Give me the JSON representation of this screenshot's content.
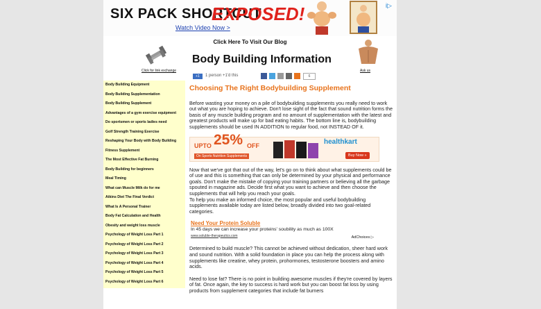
{
  "banner": {
    "title_part1": "SIX PACK SHORTCUT",
    "title_part2": "EXPOSED!",
    "cta": "Watch Video Now >",
    "ad_marker": "i▷"
  },
  "topnav": {
    "blog_link": "Click Here To Visit Our Blog"
  },
  "header": {
    "title": "Body Building Information",
    "left_link": "Click for link exchange",
    "right_link": "Ask us"
  },
  "social": {
    "google_count": "+1",
    "google_text": "1 person +1'd this",
    "share_count": "6"
  },
  "sidebar": {
    "items": [
      "Body Building Equipment",
      "Body Building Supplementation",
      "Body Building Supplement",
      "Advantages of a gym exercise equipment",
      "Do sportsmen or sports ladies need",
      "Golf Strength Training Exercise",
      "Reshaping Your Body with Body Building",
      "Fitness Supplement",
      "The Most Effective Fat Burning",
      "Body Building for beginners",
      "Meal Timing",
      "What can Muscle Milk do for me",
      "Atkins Diet The Final Verdict",
      "What Is A Personal Trainer",
      "Body Fat Calculation and Health",
      "Obesity and weight loss muscle",
      "Psychology of Weight Loss Part 1",
      "Psychology of Weight Loss Part 2",
      "Psychology of Weight Loss Part 3",
      "Psychology of Weight Loss Part 4",
      "Psychology of Weight Loss Part 5",
      "Psychology of Weight Loss Part 6"
    ]
  },
  "article": {
    "heading": "Choosing The Right Bodybuilding Supplement",
    "p1": "Before wasting your money on a pile of bodybuilding supplements you really need to work out what you are hoping to achieve. Don't lose sight of the fact that sound nutrition forms the basis of any muscle building program and no amount of supplementation with the latest and greatest products will make up for bad eating habits. The bottom line is, bodybuilding supplements should be used IN ADDITION to regular food, not INSTEAD OF it.",
    "p2": "Now that we've got that out of the way, let's go on to think about what supplements could be of use and this is something that can only be determined by your physical and performance goals. Don't make the mistake of copying your training partners or believing all the garbage spouted in magazine ads. Decide first what you want to achieve and then choose the supplements that will help you reach your goals.",
    "p3": "To help you make an informed choice, the most popular and useful bodybuilding supplements available today are listed below, broadly divided into two goal-related categories.",
    "p4": "Determined to build muscle? This cannot be achieved without dedication, sheer hard work and sound nutrition. With a solid foundation in place you can help the process along with supplements like creatine, whey protein, prohormones, testosterone boosters and amino acids.",
    "p5": "Need to lose fat? There is no point in building awesome muscles if they're covered by layers of fat. Once again, the key to success is hard work but you can boost fat loss by using products from supplement categories that include fat burners"
  },
  "promo": {
    "upto": "UPTO",
    "percent": "25%",
    "off": "OFF",
    "sub": "On Sports Nutrition Supplements",
    "brand": "healthkart",
    "buy": "Buy Now »"
  },
  "textad": {
    "title": "Need Your Protein Soluble",
    "text": "In 45 days we can increase your proteins' soubility as much as 100X",
    "url": "www.soluble-therapeutics.com",
    "adchoices": "AdChoices ▷"
  },
  "colors": {
    "accent": "#e8731c",
    "sidebar_bg": "#ffffcc",
    "banner_red": "#e0221c"
  }
}
